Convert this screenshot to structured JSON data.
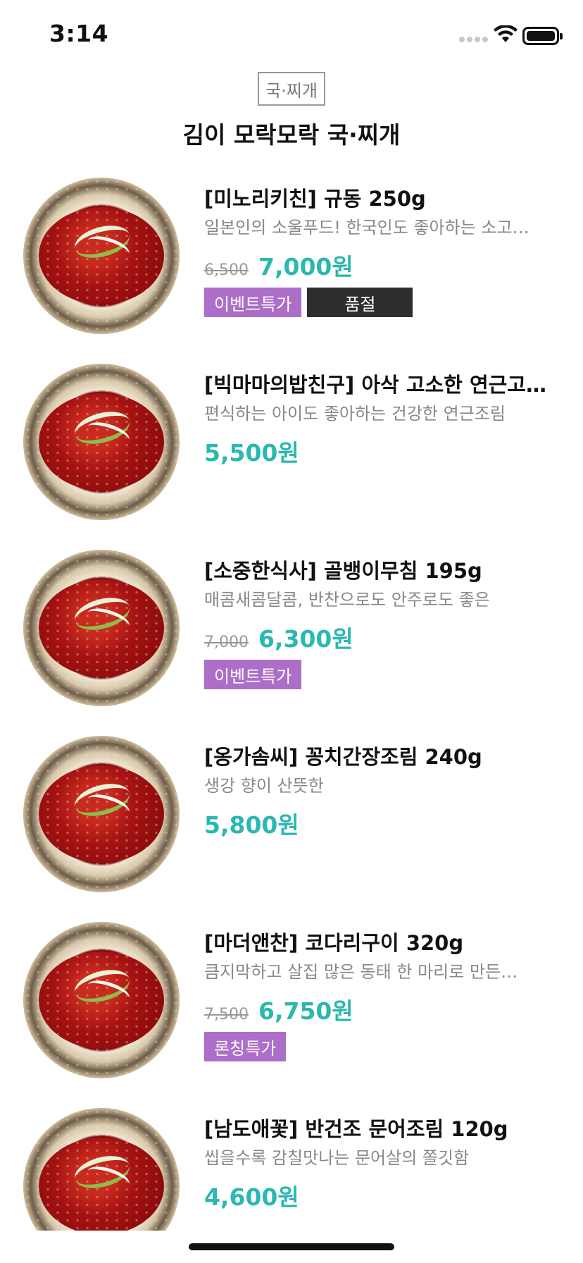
{
  "status_bar": {
    "time": "3:14"
  },
  "header": {
    "category_tag": "국·찌개",
    "title": "김이 모락모락 국·찌개"
  },
  "products": [
    {
      "name": "[미노리키친] 규동 250g",
      "desc": "일본인의 소울푸드! 한국인도 좋아하는 소고…",
      "orig_price": "6,500",
      "price": "7,000원",
      "badges": [
        {
          "label": "이벤트특가",
          "type": "event"
        },
        {
          "label": "품절",
          "type": "soldout"
        }
      ]
    },
    {
      "name": "[빅마마의밥친구] 아삭 고소한 연근고…",
      "desc": "편식하는 아이도 좋아하는 건강한 연근조림",
      "orig_price": "",
      "price": "5,500원",
      "badges": []
    },
    {
      "name": "[소중한식사] 골뱅이무침 195g",
      "desc": "매콤새콤달콤, 반찬으로도 안주로도 좋은",
      "orig_price": "7,000",
      "price": "6,300원",
      "badges": [
        {
          "label": "이벤트특가",
          "type": "event"
        }
      ]
    },
    {
      "name": "[옹가솜씨] 꽁치간장조림 240g",
      "desc": "생강 향이 산뜻한",
      "orig_price": "",
      "price": "5,800원",
      "badges": []
    },
    {
      "name": "[마더앤찬] 코다리구이 320g",
      "desc": "큼지막하고 살집 많은 동태 한 마리로 만든…",
      "orig_price": "7,500",
      "price": "6,750원",
      "badges": [
        {
          "label": "론칭특가",
          "type": "event"
        }
      ]
    },
    {
      "name": "[남도애꽃] 반건조 문어조림 120g",
      "desc": "씹을수록 감칠맛나는 문어살의 쫄깃함",
      "orig_price": "",
      "price": "4,600원",
      "badges": []
    }
  ],
  "colors": {
    "accent": "#2bb8b0",
    "event_badge": "#ac6ec7",
    "soldout_badge": "#2e2e2e"
  },
  "icons": [
    "signal-dots-icon",
    "wifi-icon",
    "battery-icon"
  ]
}
